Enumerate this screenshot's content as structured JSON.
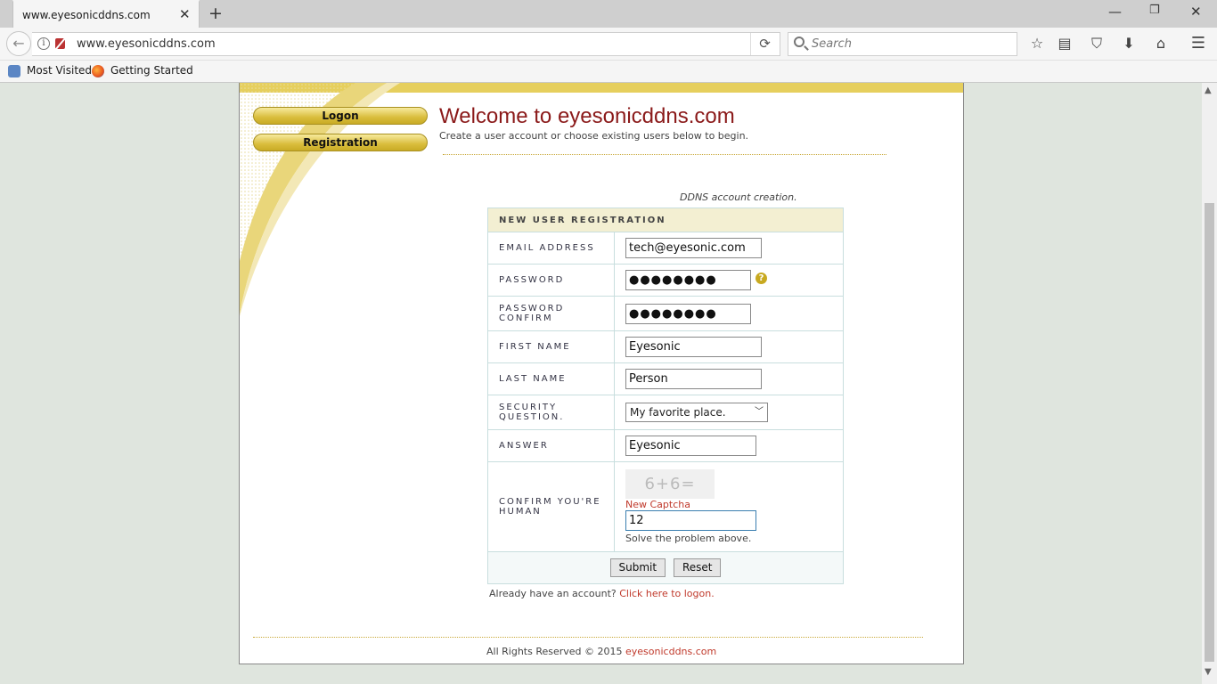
{
  "browser": {
    "tab_title": "www.eyesonicddns.com",
    "url": "www.eyesonicddns.com",
    "search_placeholder": "Search",
    "bookmarks": [
      "Most Visited",
      "Getting Started"
    ]
  },
  "nav": {
    "logon_label": "Logon",
    "registration_label": "Registration"
  },
  "header": {
    "title": "Welcome to eyesonicddns.com",
    "subtitle": "Create a user account or choose existing users below to begin."
  },
  "form": {
    "caption": "DDNS account creation.",
    "heading": "NEW USER REGISTRATION",
    "labels": {
      "email": "EMAIL ADDRESS",
      "password": "PASSWORD",
      "password_confirm_1": "PASSWORD",
      "password_confirm_2": "CONFIRM",
      "first_name": "FIRST NAME",
      "last_name": "LAST NAME",
      "security_1": "SECURITY",
      "security_2": "QUESTION.",
      "answer": "ANSWER",
      "human_1": "CONFIRM YOU'RE",
      "human_2": "HUMAN"
    },
    "values": {
      "email": "tech@eyesonic.com",
      "password": "●●●●●●●●",
      "password_confirm": "●●●●●●●●",
      "first_name": "Eyesonic",
      "last_name": "Person",
      "security_question": "My favorite place.",
      "answer": "Eyesonic",
      "captcha_answer": "12"
    },
    "captcha_image_text": "6+6=",
    "new_captcha": "New Captcha",
    "captcha_hint": "Solve the problem above.",
    "submit_label": "Submit",
    "reset_label": "Reset"
  },
  "after_form": {
    "question": "Already have an account?",
    "link": "Click here to logon."
  },
  "footer": {
    "text": "All Rights Reserved © 2015",
    "link": "eyesonicddns.com"
  },
  "colors": {
    "accent_gold": "#e6cf5d",
    "title_red": "#8b1a1a",
    "link_red": "#c0392b"
  }
}
